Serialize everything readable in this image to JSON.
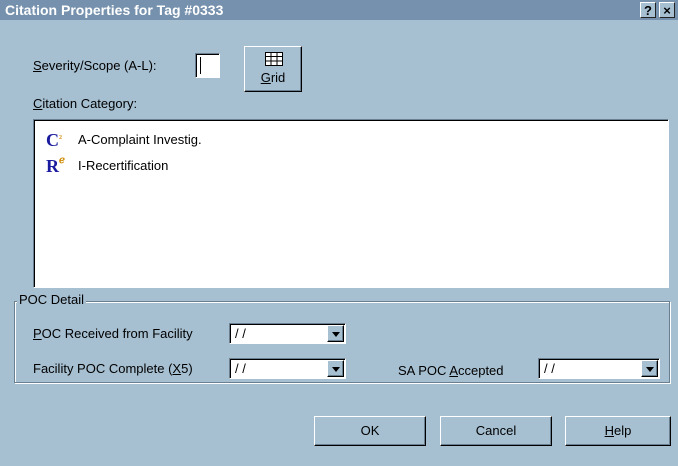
{
  "window": {
    "title": "Citation Properties for Tag #0333",
    "help_glyph": "?",
    "close_glyph": "×"
  },
  "severity": {
    "label_access": "S",
    "label_rest": "everity/Scope (A-L):",
    "value": ""
  },
  "grid_button": {
    "access": "G",
    "rest": "rid",
    "icon": "grid-icon"
  },
  "category": {
    "label_access": "C",
    "label_rest": "itation Category:",
    "items": [
      {
        "glyph": "C",
        "mark": "₂",
        "label": "A-Complaint Investig."
      },
      {
        "glyph": "R",
        "mark": "ℯ",
        "label": "I-Recertification"
      }
    ]
  },
  "poc_detail": {
    "legend": "POC Detail",
    "received": {
      "label_access": "P",
      "label_rest": "OC Received from Facility",
      "value": "/ /"
    },
    "complete": {
      "label_pre": "Facility POC Complete (",
      "label_access": "X",
      "label_post": "5)",
      "value": "/ /"
    },
    "accepted": {
      "label_pre": "SA POC ",
      "label_access": "A",
      "label_post": "ccepted",
      "value": "/ /"
    }
  },
  "buttons": {
    "ok": "OK",
    "cancel": "Cancel",
    "help_access": "H",
    "help_rest": "elp"
  }
}
